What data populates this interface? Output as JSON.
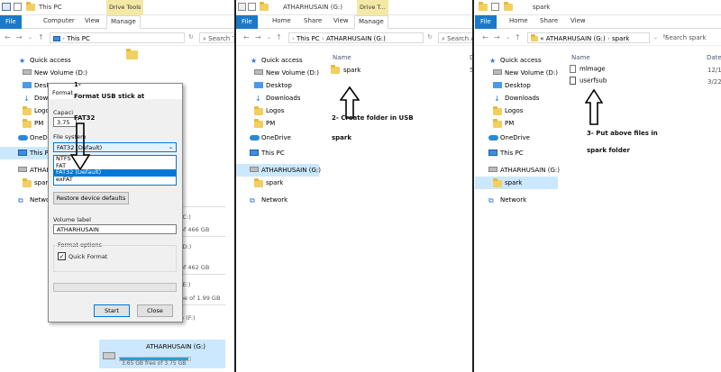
{
  "left": {
    "window_title": "This PC",
    "contextual_tab": "Drive Tools",
    "tabs": [
      "File",
      "Computer",
      "View",
      "Manage"
    ],
    "address": "This PC",
    "search_placeholder": "Search Th...",
    "sidebar": {
      "quick_access": "Quick access",
      "items": [
        "New Volume (D:)",
        "Desktop",
        "Downloads",
        "Logos",
        "PM"
      ],
      "onedrive": "OneDrive",
      "this_pc": "This PC",
      "usb": "ATHARHUSAIN (G:)",
      "spark": "spark",
      "network": "Network"
    },
    "background": {
      "g1": "(C:)",
      "g2": "of 466 GB",
      "g3": "(D:)",
      "g4": "of 462 GB",
      "g5": "(E:)",
      "g6": "ee of 1.99 GB",
      "g7": "e (F:)",
      "usb_name": "ATHARHUSAIN (G:)",
      "usb_space": "3.65 GB free of 3.75 GB",
      "usb_fill": 0.97
    },
    "dialog": {
      "title": "Format",
      "capacity_label": "Capaci",
      "capacity_value": "3.75",
      "filesystem_label": "File system",
      "filesystem_selected": "FAT32 (Default)",
      "options": [
        "NTFS",
        "FAT",
        "FAT32 (Default)",
        "exFAT"
      ],
      "restore_button": "Restore device defaults",
      "volume_label": "Volume label",
      "volume_value": "ATHARHUSAIN",
      "format_options": "Format options",
      "quick_format": "Quick Format",
      "start": "Start",
      "close": "Close"
    },
    "annotation_1": "1-",
    "annotation_2": "Format USB stick at",
    "annotation_3": "FAT32"
  },
  "middle": {
    "window_title": "ATHARHUSAIN (G:)",
    "contextual_tab": "Drive T...",
    "tabs": [
      "File",
      "Home",
      "Share",
      "View",
      "Manage"
    ],
    "address_parts": [
      "This PC",
      "ATHARHUSAIN (G:)"
    ],
    "search_placeholder": "Search AT...",
    "column_name": "Name",
    "column_partial": "D",
    "files": [
      "spark"
    ],
    "file_date_partial": "5/",
    "sidebar": {
      "quick_access": "Quick access",
      "items": [
        "New Volume (D:)",
        "Desktop",
        "Downloads",
        "Logos",
        "PM"
      ],
      "onedrive": "OneDrive",
      "this_pc": "This PC",
      "usb": "ATHARHUSAIN (G:)",
      "spark": "spark",
      "network": "Network"
    },
    "annotation_1": "2- Create folder in USB",
    "annotation_2": "spark"
  },
  "right": {
    "window_title": "spark",
    "tabs": [
      "File",
      "Home",
      "Share",
      "View"
    ],
    "address_parts": [
      "«",
      "ATHARHUSAIN (G:)",
      "spark"
    ],
    "search_placeholder": "Search spark",
    "column_name": "Name",
    "column_date": "Date",
    "files": [
      "mlmage",
      "userfsub"
    ],
    "file_dates": [
      "12/1",
      "3/22"
    ],
    "sidebar": {
      "quick_access": "Quick access",
      "items": [
        "New Volume (D:)",
        "Desktop",
        "Downloads",
        "Logos",
        "PM"
      ],
      "onedrive": "OneDrive",
      "this_pc": "This PC",
      "usb": "ATHARHUSAIN (G:)",
      "spark": "spark",
      "network": "Network"
    },
    "annotation_1": "3- Put above files in",
    "annotation_2": "spark folder"
  }
}
